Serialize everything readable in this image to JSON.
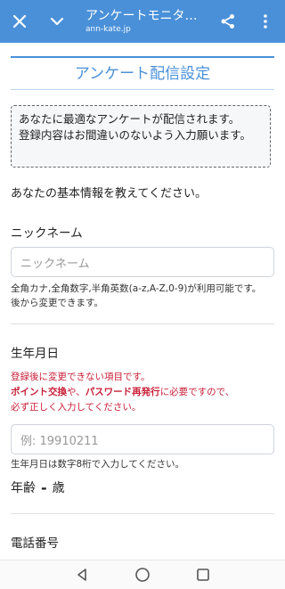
{
  "browser": {
    "title": "アンケートモニタ…",
    "domain": "ann-kate.jp",
    "icons": {
      "close": "close-icon",
      "chevron": "chevron-down-icon",
      "share": "share-icon",
      "more": "more-vertical-icon"
    },
    "accent": "#4a90d9"
  },
  "page": {
    "title": "アンケート配信設定",
    "notice_line1": "あなたに最適なアンケートが配信されます。",
    "notice_line2": "登録内容はお間違いのないよう入力願います。",
    "intro": "あなたの基本情報を教えてください。"
  },
  "nickname": {
    "label": "ニックネーム",
    "placeholder": "ニックネーム",
    "help_line1": "全角カナ,全角数字,半角英数(a-z,A-Z,0-9)が利用可能です。",
    "help_line2": "後から変更できます。"
  },
  "birthdate": {
    "label": "生年月日",
    "warn_line1": "登録後に変更できない項目です。",
    "warn_b1": "ポイント交換",
    "warn_mid": "や、",
    "warn_b2": "パスワード再発行",
    "warn_tail": "に必要ですので、",
    "warn_line3": "必ず正しく入力してください。",
    "placeholder": "例: 19910211",
    "help": "生年月日は数字8桁で入力してください。"
  },
  "age": {
    "label": "年齢",
    "value": "-",
    "unit": "歳"
  },
  "phone": {
    "label": "電話番号"
  },
  "nav": {
    "back": "back-icon",
    "home": "home-icon",
    "recent": "recent-apps-icon"
  },
  "colors": {
    "warning": "#c8203a"
  }
}
